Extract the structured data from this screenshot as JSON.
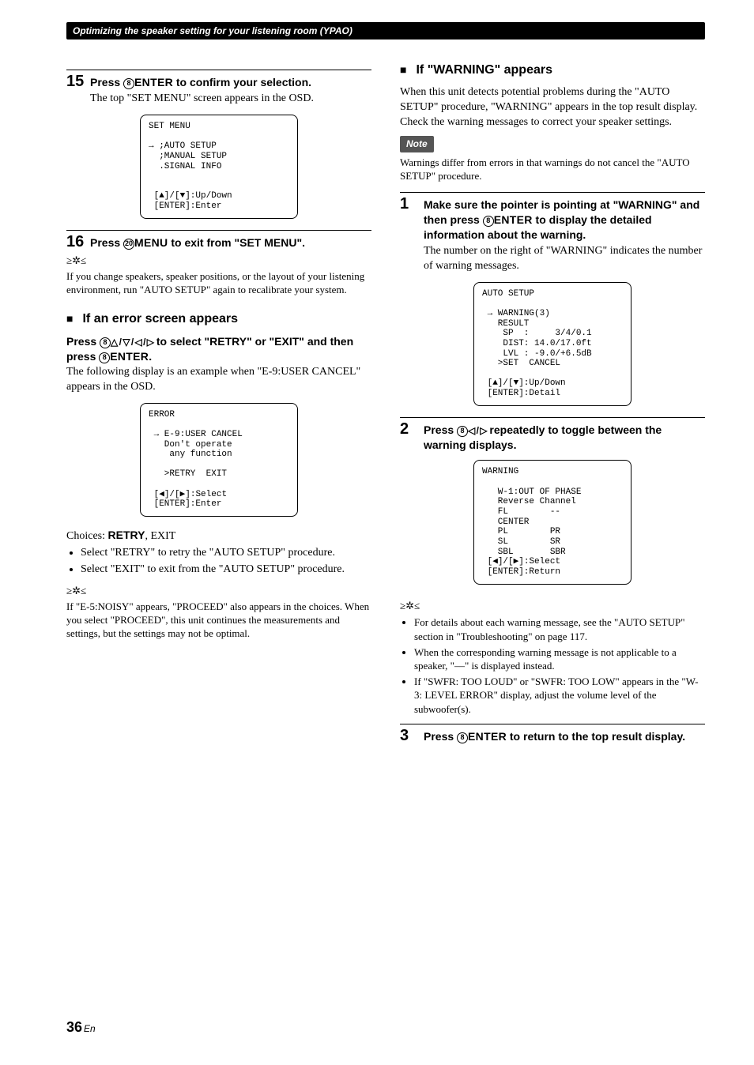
{
  "header": "Optimizing the speaker setting for your listening room (YPAO)",
  "left": {
    "step15": {
      "num": "15",
      "text_a": "Press ",
      "btn_num": "8",
      "btn_label": "ENTER",
      "text_b": " to confirm your selection.",
      "follow": "The top \"SET MENU\" screen appears in the OSD."
    },
    "osd1": "SET MENU\n\n→ ;AUTO SETUP\n  ;MANUAL SETUP\n  .SIGNAL INFO\n\n\n [▲]/[▼]:Up/Down\n [ENTER]:Enter",
    "step16": {
      "num": "16",
      "text_a": "Press ",
      "btn_num": "20",
      "btn_label": "MENU",
      "text_b": " to exit from \"SET MENU\"."
    },
    "tip1": "If you change speakers, speaker positions, or the layout of your listening environment, run \"AUTO SETUP\" again to recalibrate your system.",
    "section_error": "If an error screen appears",
    "error_press_a": "Press ",
    "error_btn_num": "8",
    "error_press_mid": " to select \"RETRY\" or \"EXIT\" and then press ",
    "error_btn2_num": "8",
    "error_btn2_label": "ENTER",
    "error_press_end": ".",
    "error_follow": "The following display is an example when \"E-9:USER CANCEL\" appears in the OSD.",
    "osd2": "ERROR\n\n → E-9:USER CANCEL\n   Don't operate\n    any function\n\n   >RETRY  EXIT\n\n [◀]/[▶]:Select\n [ENTER]:Enter",
    "choices_label": "Choices: ",
    "choices_bold": "RETRY",
    "choices_rest": ", EXIT",
    "bul1": "Select \"RETRY\" to retry the \"AUTO SETUP\" procedure.",
    "bul2": "Select \"EXIT\" to exit from the \"AUTO SETUP\" procedure.",
    "tip2": "If \"E-5:NOISY\" appears, \"PROCEED\" also appears in the choices. When you select \"PROCEED\", this unit continues the measurements and settings, but the settings may not be optimal."
  },
  "right": {
    "section_warning": "If \"WARNING\" appears",
    "warning_intro": "When this unit detects potential problems during the \"AUTO SETUP\" procedure, \"WARNING\" appears in the top result display. Check the warning messages to correct your speaker settings.",
    "note_label": "Note",
    "note_body": "Warnings differ from errors in that warnings do not cancel the \"AUTO SETUP\" procedure.",
    "step1": {
      "num": "1",
      "text_a": "Make sure the pointer is pointing at \"WARNING\" and then press ",
      "btn_num": "8",
      "btn_label": "ENTER",
      "text_b": " to display the detailed information about the warning.",
      "follow": "The number on the right of \"WARNING\" indicates the number of warning messages."
    },
    "osd3": "AUTO SETUP\n\n → WARNING(3)\n   RESULT\n    SP  :     3/4/0.1\n    DIST: 14.0/17.0ft\n    LVL : -9.0/+6.5dB\n   >SET  CANCEL\n\n [▲]/[▼]:Up/Down\n [ENTER]:Detail",
    "step2": {
      "num": "2",
      "text_a": "Press ",
      "btn_num": "8",
      "text_b": " repeatedly to toggle between the warning displays."
    },
    "osd4": "WARNING\n\n   W-1:OUT OF PHASE\n   Reverse Channel\n   FL        --\n   CENTER\n   PL        PR\n   SL        SR\n   SBL       SBR\n [◀]/[▶]:Select\n [ENTER]:Return",
    "bul1": "For details about each warning message, see the \"AUTO SETUP\" section in \"Troubleshooting\" on page 117.",
    "bul2": "When the corresponding warning message is not applicable to a speaker, \"––\" is displayed instead.",
    "bul3": "If \"SWFR: TOO LOUD\" or \"SWFR: TOO LOW\" appears in the \"W-3: LEVEL ERROR\" display, adjust the volume level of the subwoofer(s).",
    "step3": {
      "num": "3",
      "text_a": "Press ",
      "btn_num": "8",
      "btn_label": "ENTER",
      "text_b": " to return to the top result display."
    }
  },
  "page_number": "36",
  "page_lang": "En"
}
